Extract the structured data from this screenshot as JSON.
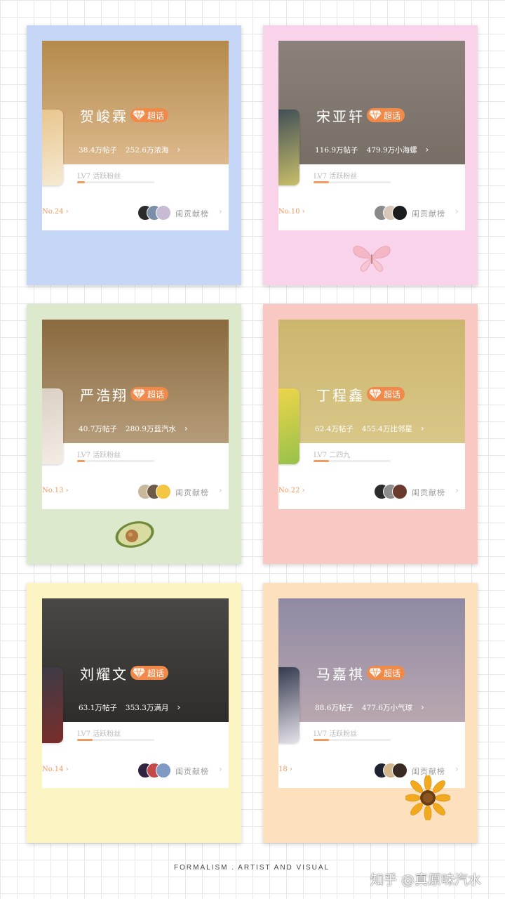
{
  "cards": [
    {
      "name": "贺峻霖",
      "badge": "超话",
      "stats": {
        "posts": "38.4万帖子",
        "fans": "252.6万浓海"
      },
      "level": "LV7 活跃粉丝",
      "level_progress": 0.1,
      "rank": "No.24",
      "contrib_label": "闺贡献榜",
      "frame_color": "#c6d6f7",
      "top_gradient": [
        "#b58a4c",
        "#dcb98d"
      ]
    },
    {
      "name": "宋亚轩",
      "badge": "超话",
      "stats": {
        "posts": "116.9万帖子",
        "fans": "479.9万小海螺"
      },
      "level": "LV7 活跃粉丝",
      "level_progress": 0.2,
      "rank": "No.10",
      "contrib_label": "闺贡献榜",
      "frame_color": "#f9d3ea",
      "top_gradient": [
        "#8a827a",
        "#776f66"
      ]
    },
    {
      "name": "严浩翔",
      "badge": "超话",
      "stats": {
        "posts": "40.7万帖子",
        "fans": "280.9万蓝汽水"
      },
      "level": "LV7 活跃粉丝",
      "level_progress": 0.1,
      "rank": "No.13",
      "contrib_label": "闺贡献榜",
      "frame_color": "#dde9cc",
      "top_gradient": [
        "#8a6a3f",
        "#b59c79"
      ]
    },
    {
      "name": "丁程鑫",
      "badge": "超话",
      "stats": {
        "posts": "62.4万帖子",
        "fans": "455.4万比邻星"
      },
      "level": "LV7 二四九",
      "level_progress": 0.2,
      "rank": "No.22",
      "contrib_label": "闺贡献榜",
      "frame_color": "#f9c8c2",
      "top_gradient": [
        "#cbb66d",
        "#d9c789"
      ]
    },
    {
      "name": "刘耀文",
      "badge": "超话",
      "stats": {
        "posts": "63.1万帖子",
        "fans": "353.3万满月"
      },
      "level": "LV7 活跃粉丝",
      "level_progress": 0.2,
      "rank": "No.14",
      "contrib_label": "闺贡献榜",
      "frame_color": "#fdf4c3",
      "top_gradient": [
        "#4a4845",
        "#2e2d2b"
      ]
    },
    {
      "name": "马嘉祺",
      "badge": "超话",
      "stats": {
        "posts": "88.6万帖子",
        "fans": "477.6万小气球"
      },
      "level": "LV7 活跃粉丝",
      "level_progress": 0.2,
      "rank": "18",
      "contrib_label": "闺贡献榜",
      "frame_color": "#fde1bf",
      "top_gradient": [
        "#8f8aa3",
        "#b9a7b0"
      ]
    }
  ],
  "footer_text": "FORMALISM . ARTIST AND VISUAL",
  "watermark": "知乎 @真原味汽水",
  "icons": {
    "badge": "diamond-icon",
    "chevron": "chevron-right-icon",
    "butterfly": "butterfly-icon",
    "avocado": "avocado-icon",
    "sunflower": "sunflower-icon"
  }
}
